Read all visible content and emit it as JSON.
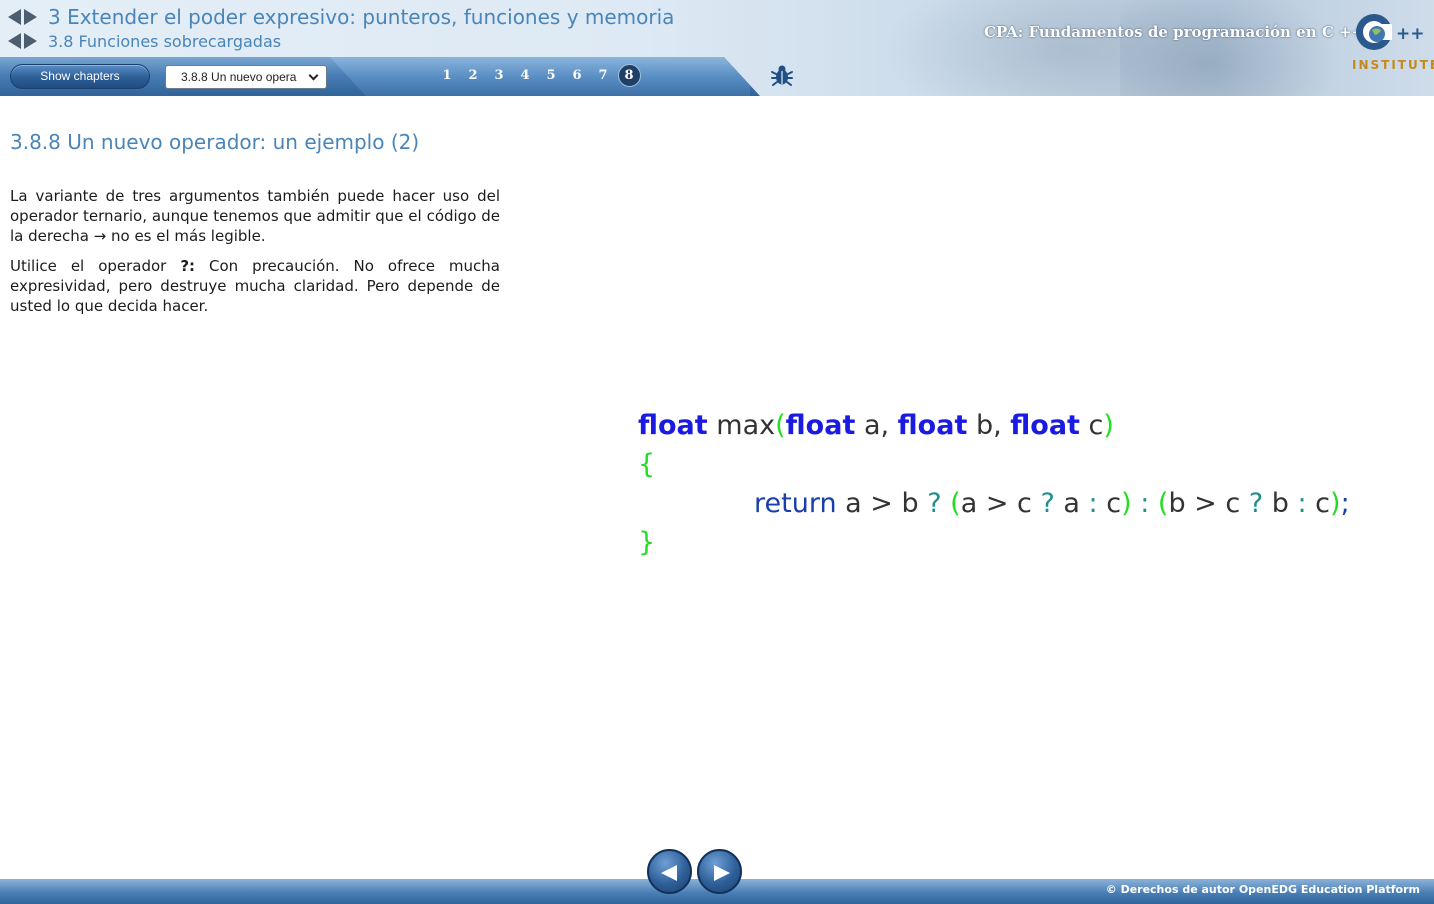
{
  "header": {
    "chapter_title": "3 Extender el poder expresivo: punteros, funciones y memoria",
    "section_title": "3.8 Funciones sobrecargadas",
    "course_title": "CPA: Fundamentos de programación en C ++",
    "logo_text": "INSTITUTE"
  },
  "toolbar": {
    "show_chapters_label": "Show chapters",
    "chapter_select_value": "3.8.8 Un nuevo opera",
    "pages": [
      "1",
      "2",
      "3",
      "4",
      "5",
      "6",
      "7",
      "8"
    ],
    "active_page": "8",
    "bug_icon": "bug-icon"
  },
  "content": {
    "heading": "3.8.8 Un nuevo operador: un ejemplo (2)",
    "paragraph1": "La variante de tres argumentos también puede hacer uso del operador ternario, aunque tenemos que admitir que el código de la derecha → no es el más legible.",
    "paragraph2_prefix": "Utilice el operador ",
    "paragraph2_bold": "?:",
    "paragraph2_suffix": " Con precaución. No ofrece mucha expresividad, pero destruye mucha claridad. Pero depende de usted lo que decida hacer."
  },
  "code": {
    "line1": [
      "float",
      " max",
      "(",
      "float",
      " a, ",
      "float",
      " b, ",
      "float",
      " c",
      ")"
    ],
    "line2": "{",
    "line3": [
      "return",
      " a > b ",
      "?",
      " ",
      "(",
      "a > c ",
      "?",
      " a ",
      ":",
      " c",
      ")",
      " ",
      ":",
      " ",
      "(",
      "b > c ",
      "?",
      " b ",
      ":",
      " c",
      ")",
      ";"
    ],
    "line4": "}"
  },
  "footer": {
    "copyright": "© Derechos de autor OpenEDG Education Platform",
    "prev_icon": "left-arrow-icon",
    "next_icon": "right-arrow-icon"
  },
  "colors": {
    "accent": "#4a85b8",
    "keyword": "#1a1ae0",
    "paren": "#22dd22",
    "operator": "#1f8f8f",
    "toolbar": "#2f6399"
  }
}
